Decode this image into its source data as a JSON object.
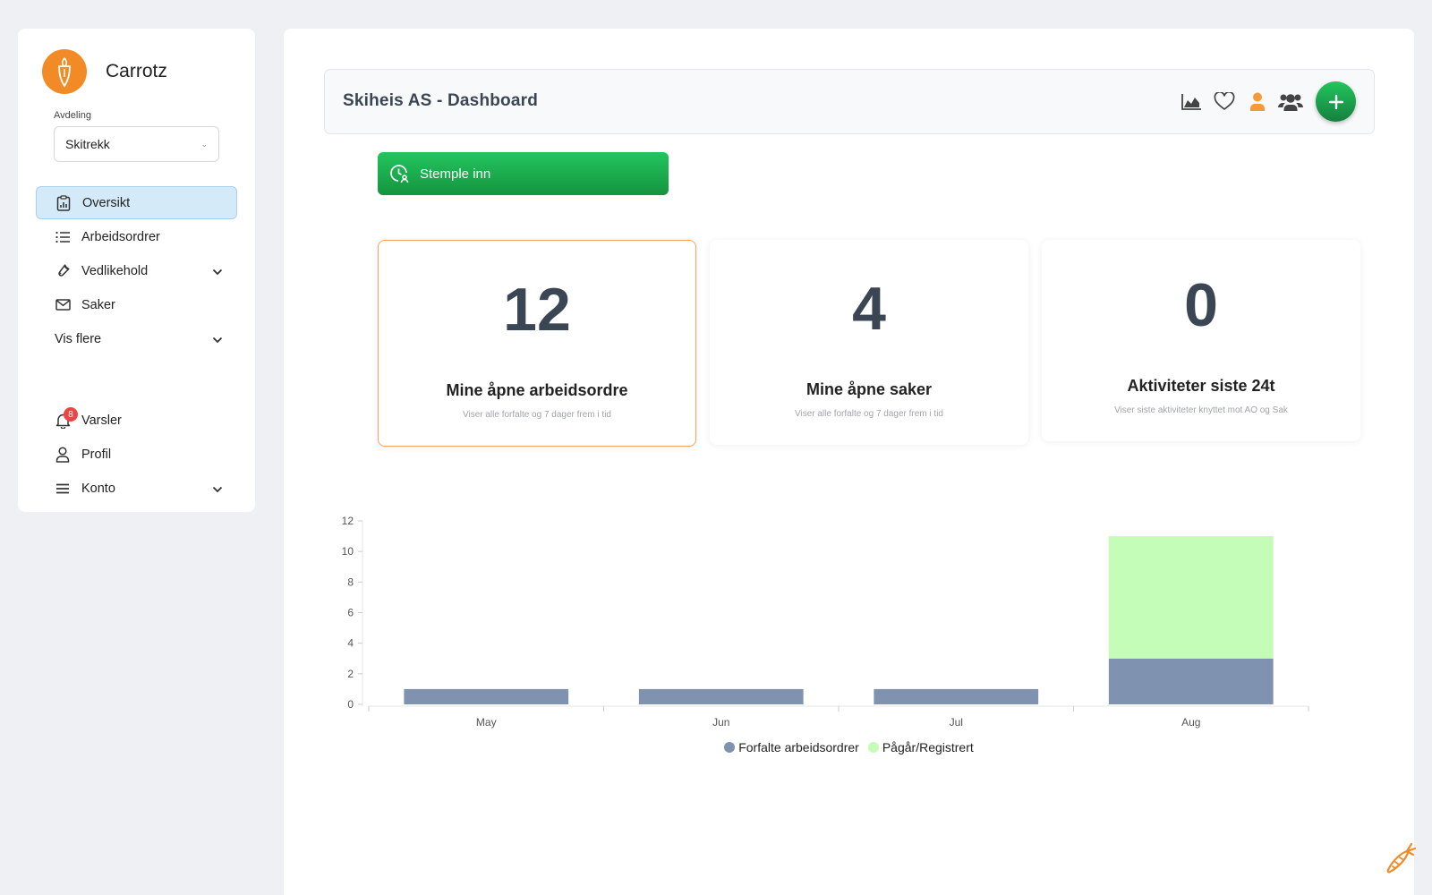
{
  "app": {
    "name": "Carrotz"
  },
  "department": {
    "label": "Avdeling",
    "selected": "Skitrekk"
  },
  "nav": {
    "overview": "Oversikt",
    "workorders": "Arbeidsordrer",
    "maintenance": "Vedlikehold",
    "cases": "Saker",
    "more": "Vis flere",
    "alerts": "Varsler",
    "alerts_count": "8",
    "profile": "Profil",
    "account": "Konto"
  },
  "header": {
    "title": "Skiheis AS - Dashboard"
  },
  "stamp": {
    "label": "Stemple inn"
  },
  "stats": [
    {
      "value": "12",
      "label": "Mine åpne arbeidsordre",
      "sub": "Viser alle forfalte og 7 dager frem i tid"
    },
    {
      "value": "4",
      "label": "Mine åpne saker",
      "sub": "Viser alle forfalte og 7 dager frem i tid"
    },
    {
      "value": "0",
      "label": "Aktiviteter siste 24t",
      "sub": "Viser siste aktiviteter knyttet mot AO og Sak"
    }
  ],
  "colors": {
    "accent": "#f28b26",
    "primary_green": "#16a34a",
    "series_overdue": "#7f92b0",
    "series_progress": "#c3fdb8"
  },
  "chart_data": {
    "type": "bar",
    "stacked": true,
    "categories": [
      "May",
      "Jun",
      "Jul",
      "Aug"
    ],
    "series": [
      {
        "name": "Forfalte arbeidsordrer",
        "values": [
          1,
          1,
          1,
          3
        ],
        "color": "#7f92b0"
      },
      {
        "name": "Pågår/Registrert",
        "values": [
          0,
          0,
          0,
          8
        ],
        "color": "#c3fdb8"
      }
    ],
    "yticks": [
      "0",
      "2",
      "4",
      "6",
      "8",
      "10",
      "12"
    ],
    "ylim": [
      0,
      12
    ],
    "legend": "bottom-center"
  }
}
